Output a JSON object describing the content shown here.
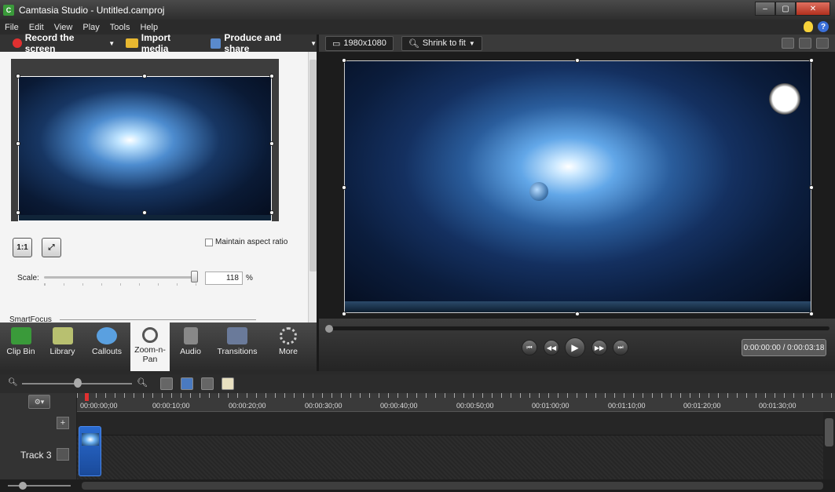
{
  "window": {
    "title": "Camtasia Studio - Untitled.camproj",
    "min": "‒",
    "max": "▢",
    "close": "✕"
  },
  "menu": [
    "File",
    "Edit",
    "View",
    "Play",
    "Tools",
    "Help"
  ],
  "toolbar": {
    "record": "Record the screen",
    "import": "Import media",
    "produce": "Produce and share"
  },
  "preview": {
    "resolution": "1980x1080",
    "zoom": "Shrink to fit"
  },
  "zoom_panel": {
    "one_to_one": "1:1",
    "maintain_aspect": "Maintain aspect ratio",
    "scale_label": "Scale:",
    "scale_value": "118",
    "scale_unit": "%",
    "smartfocus": "SmartFocus"
  },
  "tabs": [
    {
      "label": "Clip Bin",
      "icon": "clip-bin-icon"
    },
    {
      "label": "Library",
      "icon": "library-icon"
    },
    {
      "label": "Callouts",
      "icon": "callouts-icon"
    },
    {
      "label": "Zoom-n-Pan",
      "icon": "zoom-icon"
    },
    {
      "label": "Audio",
      "icon": "audio-icon"
    },
    {
      "label": "Transitions",
      "icon": "transitions-icon"
    },
    {
      "label": "More",
      "icon": "more-icon"
    }
  ],
  "transport": {
    "timecode": "0:00:00:00 / 0:00:03:18"
  },
  "timeline": {
    "ruler": [
      "00:00:00;00",
      "00:00:10;00",
      "00:00:20;00",
      "00:00:30;00",
      "00:00:40;00",
      "00:00:50;00",
      "00:01:00;00",
      "00:01:10;00",
      "00:01:20;00",
      "00:01:30;00"
    ],
    "track_label": "Track 3"
  },
  "colors": {
    "record": "#e03030",
    "clip": "#2a6bd0",
    "accent_bulb": "#f6d23a"
  }
}
